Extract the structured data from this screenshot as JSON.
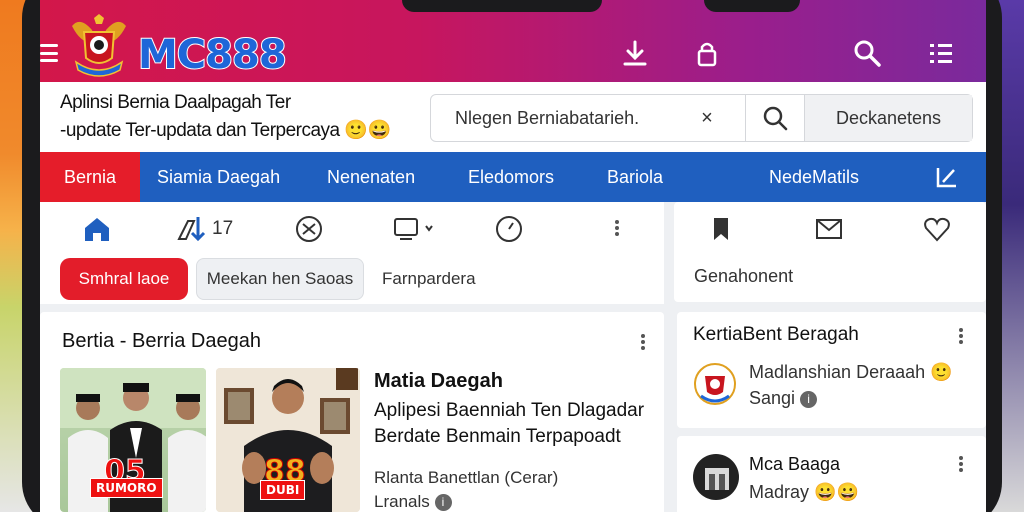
{
  "app": {
    "brand": "MC888",
    "subtitle_line1": "Aplinsi Bernia Daalpagah Ter",
    "subtitle_line2": "-update Ter-updata dan Terpercaya"
  },
  "search": {
    "placeholder": "Nlegen Berniabatarieh.",
    "clear": "×",
    "button_label": "Deckanetens"
  },
  "nav": {
    "items": [
      {
        "label": "Bernia",
        "active": true
      },
      {
        "label": "Siamia Daegah"
      },
      {
        "label": "Nenenaten"
      },
      {
        "label": "Eledomors"
      },
      {
        "label": "Bariola"
      },
      {
        "label": "NedeMatils"
      }
    ]
  },
  "toolbar": {
    "counter": "17",
    "chips": [
      "Smhral laoe",
      "Meekan hen Saoas",
      "Farnpardera"
    ]
  },
  "side_tools": {
    "label": "Genahonent"
  },
  "main_card": {
    "title": "Bertia - Berria Daegah",
    "photo_badge_1": "RUMORO",
    "photo_badge_1_num": "05",
    "photo_badge_2": "DUBI",
    "photo_badge_2_num": "88",
    "article_title": "Matia Daegah",
    "article_line1": "Aplipesi Baenniah Ten Dlagadar",
    "article_line2": "Berdate Benmain Terpapoadt",
    "meta1": "Rlanta Banettlan (Cerar)",
    "meta2": "Lranals"
  },
  "side_card_1": {
    "title": "KertiaBent Beragah",
    "line1": "Madlanshian Deraaah",
    "line2": "Sangi"
  },
  "side_card_2": {
    "line1": "Mca Baaga",
    "line2": "Madray"
  },
  "colors": {
    "topbar_start": "#d3174a",
    "topbar_end": "#7a2a9c",
    "nav_blue": "#1f5fbf",
    "accent_red": "#e31d2a",
    "brand_blue": "#1e66d8"
  },
  "icons": [
    "menu-icon",
    "download-icon",
    "lock-icon",
    "search-icon",
    "list-icon",
    "home-icon",
    "shuffle-icon",
    "cast-icon",
    "timer-icon",
    "more-icon",
    "bookmark-icon",
    "mail-icon",
    "heart-icon",
    "emoji-icon"
  ]
}
